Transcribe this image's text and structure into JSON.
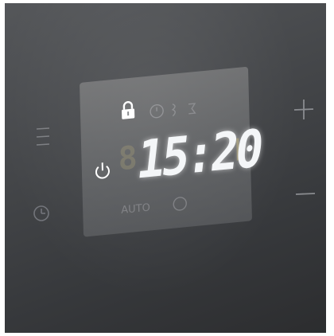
{
  "display": {
    "time": "15:20",
    "faint_text": "AUTO"
  },
  "icons": [
    "menu-icon",
    "clock-icon",
    "power-icon",
    "lock-icon",
    "timer-icon",
    "plus-icon",
    "minus-icon"
  ],
  "colors": {
    "panel": "#45474a",
    "display_glass": "#8f9193",
    "digits": "#f4f6f8",
    "ghost_segments": "#b8a466"
  }
}
